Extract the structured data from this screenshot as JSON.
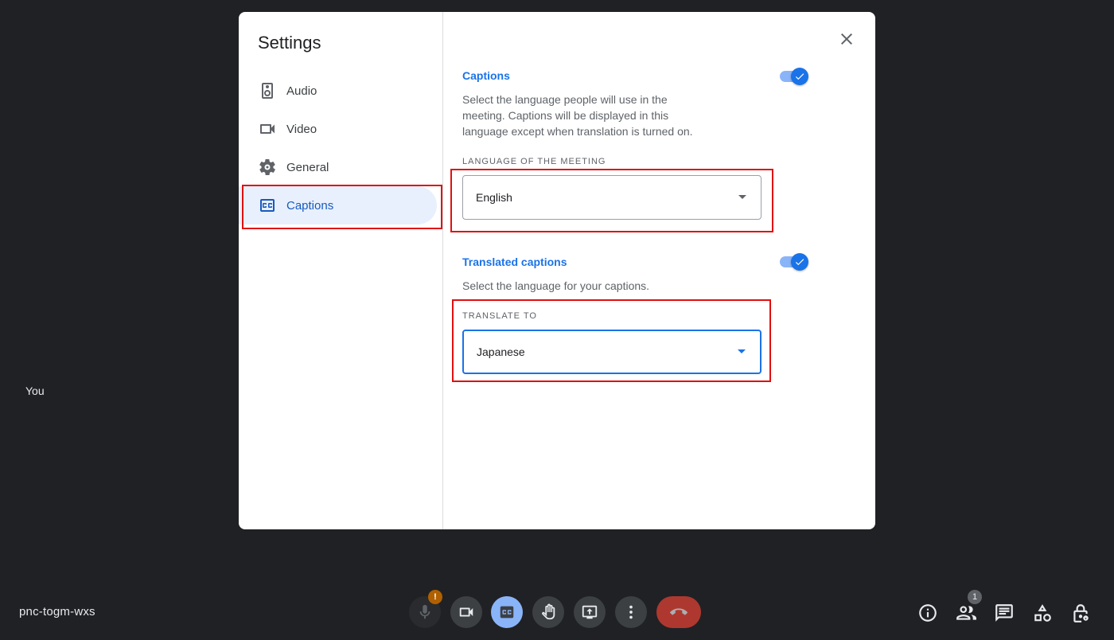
{
  "stage": {
    "participant_label": "You",
    "meeting_code": "pnc-togm-wxs",
    "mic_badge": "!",
    "people_count": "1"
  },
  "dialog": {
    "title": "Settings",
    "nav": [
      {
        "label": "Audio",
        "icon": "speaker-icon"
      },
      {
        "label": "Video",
        "icon": "videocam-icon"
      },
      {
        "label": "General",
        "icon": "gear-icon"
      },
      {
        "label": "Captions",
        "icon": "closed-caption-icon",
        "active": true
      }
    ],
    "captions": {
      "title": "Captions",
      "enabled": true,
      "description": "Select the language people will use in the meeting. Captions will be displayed in this language except when translation is turned on.",
      "language_label": "LANGUAGE OF THE MEETING",
      "language_value": "English"
    },
    "translated": {
      "title": "Translated captions",
      "enabled": true,
      "description": "Select the language for your captions.",
      "translate_label": "TRANSLATE TO",
      "translate_value": "Japanese"
    }
  },
  "colors": {
    "accent": "#1a73e8",
    "active_nav_bg": "#e8f0fe",
    "highlight": "#e01010",
    "background": "#202124",
    "end_call": "#ea4335"
  }
}
